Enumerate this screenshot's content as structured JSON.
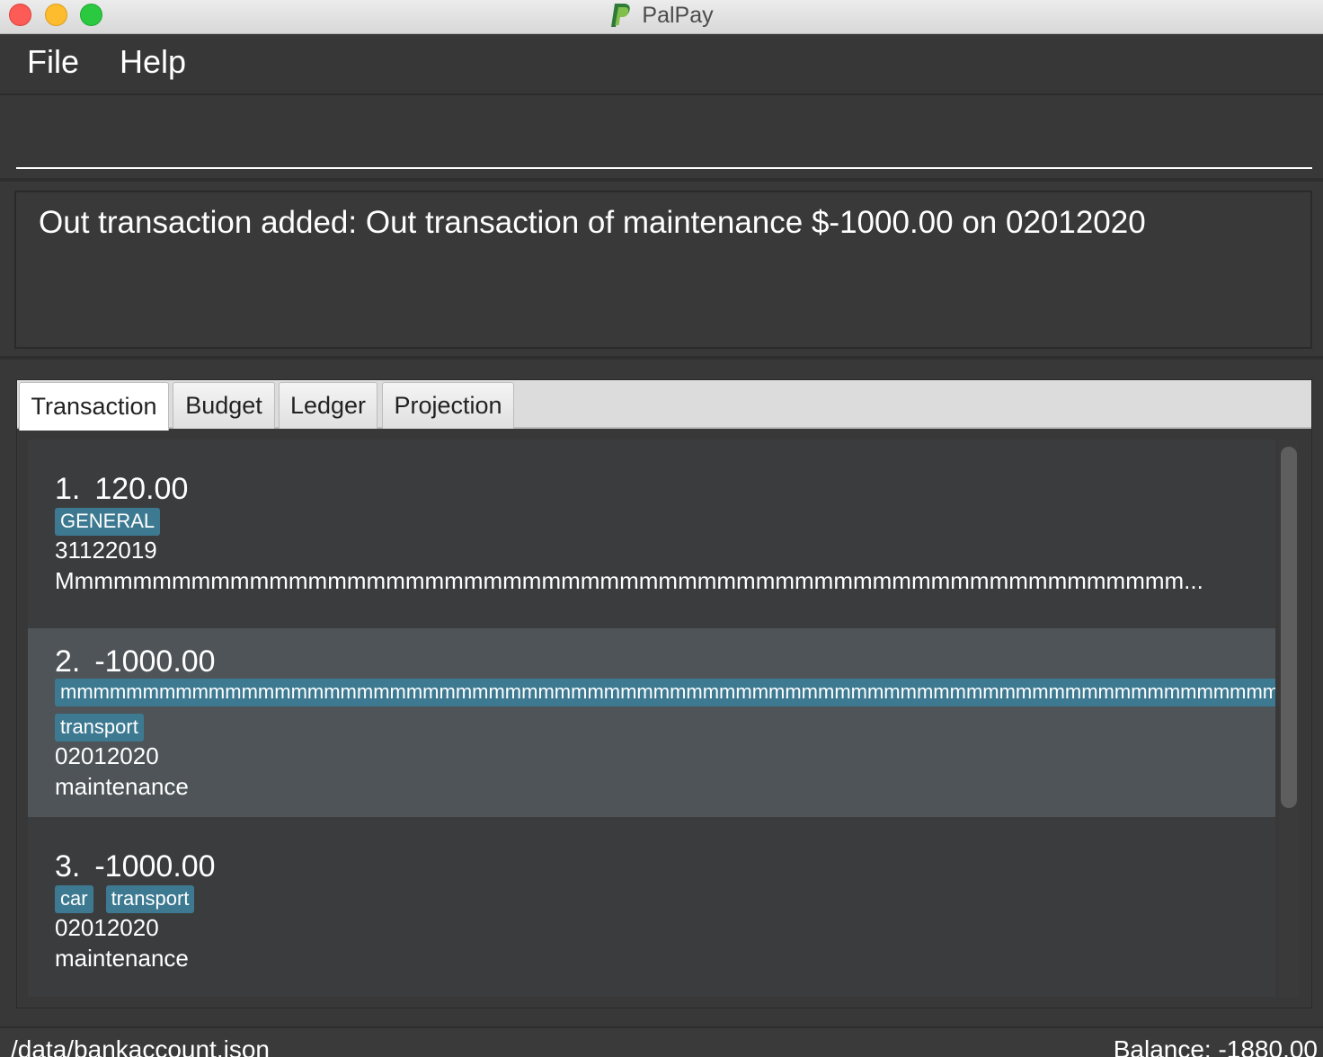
{
  "window": {
    "title": "PalPay",
    "icon": "palpay-logo-icon"
  },
  "menu": {
    "file": "File",
    "help": "Help"
  },
  "command": {
    "value": ""
  },
  "result": {
    "message": "Out transaction added: Out transaction of maintenance $-1000.00 on 02012020"
  },
  "tabs": [
    {
      "label": "Transaction",
      "active": true
    },
    {
      "label": "Budget",
      "active": false
    },
    {
      "label": "Ledger",
      "active": false
    },
    {
      "label": "Projection",
      "active": false
    }
  ],
  "transactions": [
    {
      "index": "1.",
      "amount": "120.00",
      "tags": [
        "GENERAL"
      ],
      "date": "31122019",
      "description": "Mmmmmmmmmmmmmmmmmmmmmmmmmmmmmmmmmmmmmmmmmmmmmmmmmmmmmmmmmm..."
    },
    {
      "index": "2.",
      "amount": "-1000.00",
      "long_tag": "mmmmmmmmmmmmmmmmmmmmmmmmmmmmmmmmmmmmmmmmmmmmmmmmmmmmmmmmmmmmmmmmmmmmmmmmmm",
      "tags": [
        "transport"
      ],
      "date": "02012020",
      "description": "maintenance"
    },
    {
      "index": "3.",
      "amount": "-1000.00",
      "tags": [
        "car",
        "transport"
      ],
      "date": "02012020",
      "description": "maintenance"
    }
  ],
  "status": {
    "path": "/data/bankaccount.json",
    "balance": "Balance: -1880.00"
  },
  "colors": {
    "background": "#383838",
    "tag": "#3d7a92",
    "selected_row": "#4e5458"
  }
}
